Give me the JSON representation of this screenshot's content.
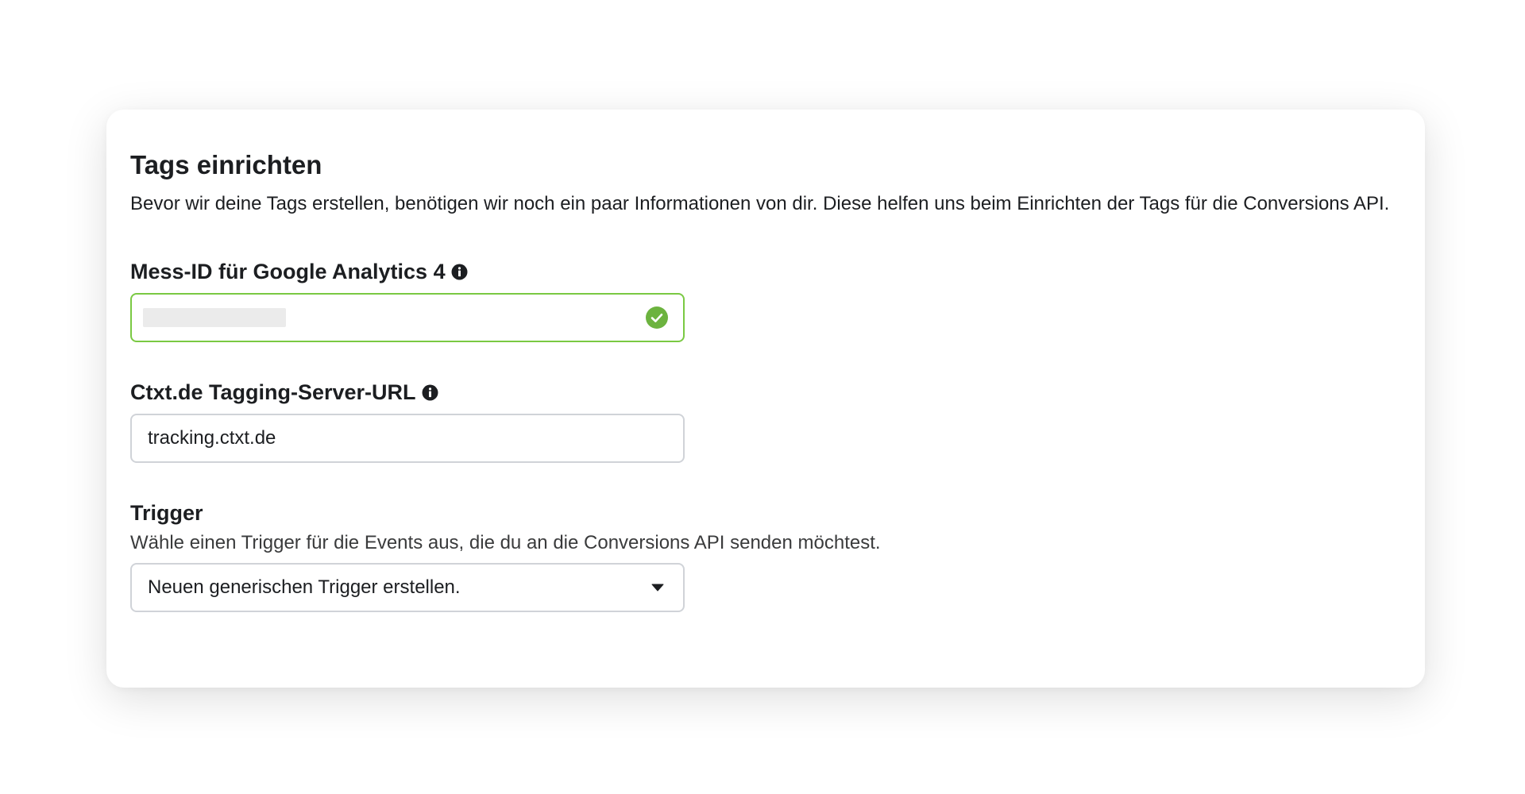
{
  "panel": {
    "title": "Tags einrichten",
    "intro": "Bevor wir deine Tags erstellen, benötigen wir noch ein paar Informationen von dir. Diese helfen uns beim Einrichten der Tags für die Conversions API."
  },
  "fields": {
    "measurement_id": {
      "label": "Mess-ID für Google Analytics 4",
      "value": "",
      "status": "valid",
      "info_icon": "info-circle-icon",
      "status_icon": "check-circle-icon"
    },
    "server_url": {
      "label": "Ctxt.de Tagging-Server-URL",
      "value": "tracking.ctxt.de",
      "info_icon": "info-circle-icon"
    },
    "trigger": {
      "label": "Trigger",
      "help": "Wähle einen Trigger für die Events aus, die du an die Conversions API senden möchtest.",
      "selected": "Neuen generischen Trigger erstellen.",
      "caret_icon": "caret-down-icon"
    }
  },
  "colors": {
    "valid_border": "#7ac943",
    "valid_icon": "#6cb33f",
    "default_border": "#d0d3d8",
    "text": "#1c1e21"
  }
}
